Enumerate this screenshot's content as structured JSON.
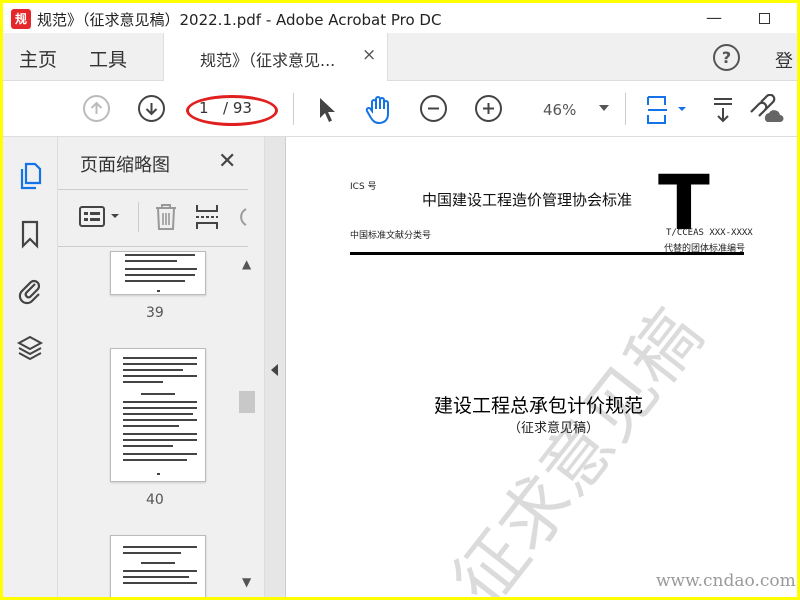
{
  "window": {
    "title": "规范》（征求意见稿）2022.1.pdf - Adobe Acrobat Pro DC",
    "app_icon_label": "规",
    "minimize": "—"
  },
  "menu": {
    "home": "主页",
    "tools": "工具",
    "doc_tab": "规范》（征求意见...",
    "close": "×",
    "help": "?",
    "login": "登"
  },
  "toolbar": {
    "page_current": "1",
    "page_total": "/ 93",
    "zoom": "46%"
  },
  "thumbnails": {
    "title": "页面缩略图",
    "close": "✕",
    "pages": [
      "39",
      "40"
    ],
    "scroll_up": "▲",
    "scroll_down": "▼"
  },
  "document": {
    "ics": "ICS 号",
    "org": "中国建设工程造价管理协会标准",
    "big_letter": "T",
    "classification": "中国标准文献分类号",
    "code": "T/CCEAS XXX-XXXX",
    "replaces": "代替的团体标准编号",
    "title": "建设工程总承包计价规范",
    "subtitle": "（征求意见稿）",
    "watermark": "征求意见稿",
    "site": "www.cndao.com"
  },
  "colors": {
    "frame_border": "#ffff00",
    "accent_blue": "#1473e6",
    "annotation_red": "#e02020"
  }
}
